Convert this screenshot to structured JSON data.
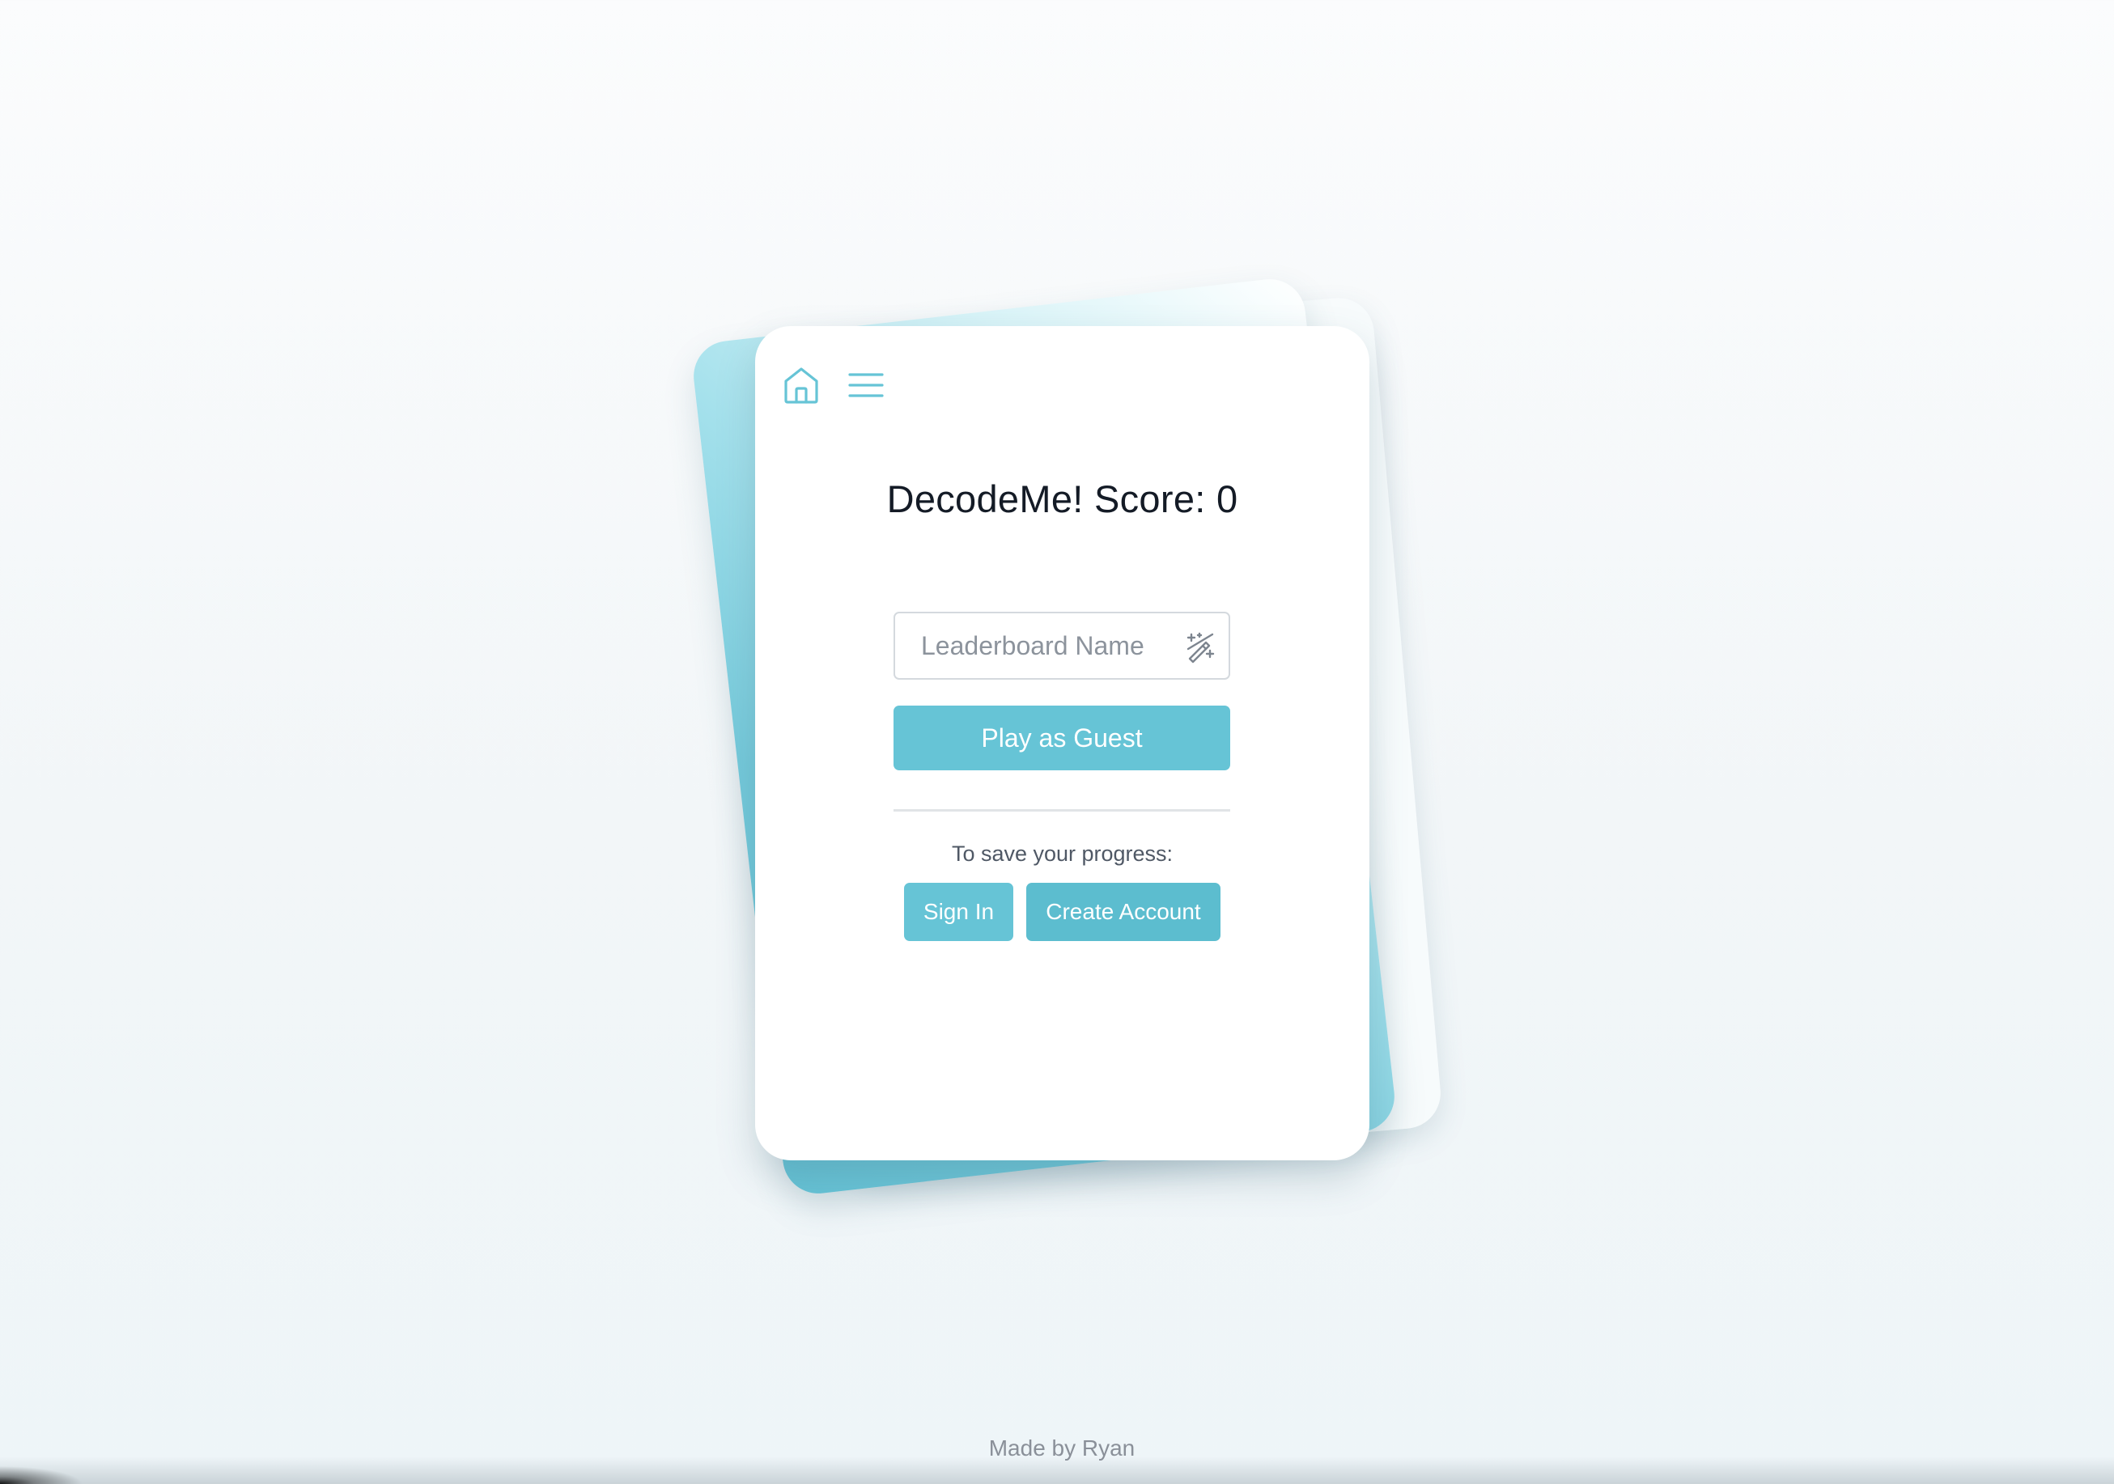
{
  "nav": {
    "home_icon": "home-icon",
    "menu_icon": "hamburger-menu-icon"
  },
  "title": "DecodeMe! Score: 0",
  "leaderboard": {
    "placeholder": "Leaderboard Name",
    "value": "",
    "generate_icon": "magic-wand-icon"
  },
  "guest_button_label": "Play as Guest",
  "save_prompt": "To save your progress:",
  "auth": {
    "sign_in_label": "Sign In",
    "create_account_label": "Create Account"
  },
  "footer": "Made by Ryan",
  "colors": {
    "accent": "#66c4d6",
    "accent_dark": "#5cbdcf",
    "title_text": "#141b26",
    "background": "#f2f6f8"
  }
}
